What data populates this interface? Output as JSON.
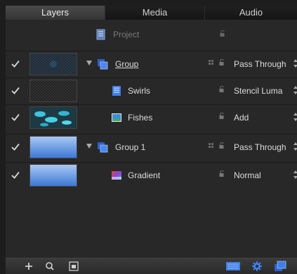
{
  "tabs": [
    {
      "label": "Layers",
      "active": true
    },
    {
      "label": "Media",
      "active": false
    },
    {
      "label": "Audio",
      "active": false
    }
  ],
  "project": {
    "label": "Project"
  },
  "layers": [
    {
      "name": "Group",
      "type": "group",
      "checked": true,
      "blend": "Pass Through",
      "underlined": true
    },
    {
      "name": "Swirls",
      "type": "layer",
      "checked": true,
      "blend": "Stencil Luma"
    },
    {
      "name": "Fishes",
      "type": "image",
      "checked": true,
      "blend": "Add"
    },
    {
      "name": "Group 1",
      "type": "group",
      "checked": true,
      "blend": "Pass Through"
    },
    {
      "name": "Gradient",
      "type": "gradient",
      "checked": true,
      "blend": "Normal"
    }
  ],
  "toolbar": {
    "left_icons": [
      "add-icon",
      "search-icon",
      "thumbnail-toggle-icon"
    ],
    "right_icons": [
      "thumbnail-view-icon",
      "gear-icon",
      "layers-mask-icon"
    ]
  },
  "colors": {
    "accent_blue": "#3f7ee8",
    "panel_bg": "#282828"
  }
}
